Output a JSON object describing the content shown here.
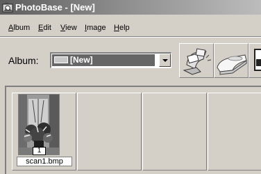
{
  "window": {
    "title": "PhotoBase - [New]",
    "icon": "photobase-app-icon"
  },
  "menu": [
    {
      "label": "Album",
      "underline": "A",
      "rest": "lbum"
    },
    {
      "label": "Edit",
      "underline": "E",
      "rest": "dit"
    },
    {
      "label": "View",
      "underline": "V",
      "rest": "iew"
    },
    {
      "label": "Image",
      "underline": "I",
      "rest": "mage"
    },
    {
      "label": "Help",
      "underline": "H",
      "rest": "elp"
    }
  ],
  "album": {
    "label": "Album:",
    "selected": "[New]"
  },
  "toolbar": [
    {
      "name": "acquire-photos-icon"
    },
    {
      "name": "scanner-icon"
    },
    {
      "name": "printer-icon"
    }
  ],
  "thumbnails": [
    {
      "number": "1",
      "filename": "scan1.bmp"
    }
  ],
  "colors": {
    "titlebar_start": "#5e5e5e",
    "titlebar_end": "#bcbcbc",
    "face": "#d4d0c8",
    "selection": "#666666"
  }
}
